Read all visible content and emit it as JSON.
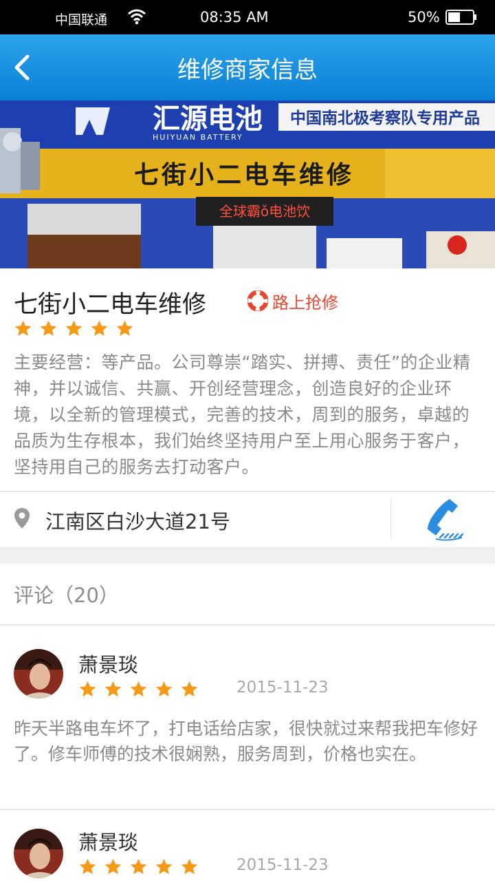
{
  "status_bar": {
    "carrier": "中国联通",
    "time": "08:35 AM",
    "battery": "50%",
    "battery_level": 0.5
  },
  "nav": {
    "title": "维修商家信息",
    "back_icon": "chevron-left-icon"
  },
  "banner": {
    "brand_name": "汇源电池",
    "brand_latin": "HUIYUAN BATTERY",
    "brand_slogan": "中国南北极考察队专用产品",
    "shop_sign": "七街小二电车维修",
    "led_sign": "全球霸ǒ电池饮"
  },
  "shop": {
    "name": "七街小二电车维修",
    "service_badge": "路上抢修",
    "rating": 5,
    "rating_max": 5,
    "description": "主要经营：等产品。公司尊崇“踏实、拼搏、责任”的企业精神，并以诚信、共赢、开创经营理念，创造良好的企业环境，以全新的管理模式，完善的技术，周到的服务，卓越的品质为生存根本，我们始终坚持用户至上用心服务于客户，坚持用自己的服务去打动客户。",
    "address": "江南区白沙大道21号"
  },
  "comments": {
    "header": "评论（20）",
    "items": [
      {
        "user": "萧景琰",
        "rating": 5,
        "date": "2015-11-23",
        "text": "昨天半路电车坏了，打电话给店家，很快就过来帮我把车修好了。修车师傅的技术很娴熟，服务周到，价格也实在。"
      },
      {
        "user": "萧景琰",
        "rating": 5,
        "date": "2015-11-23",
        "text": ""
      }
    ]
  },
  "colors": {
    "nav_blue": "#1592e2",
    "star_orange": "#f59a18",
    "badge_red": "#e8452f",
    "phone_blue": "#2b8de0"
  }
}
